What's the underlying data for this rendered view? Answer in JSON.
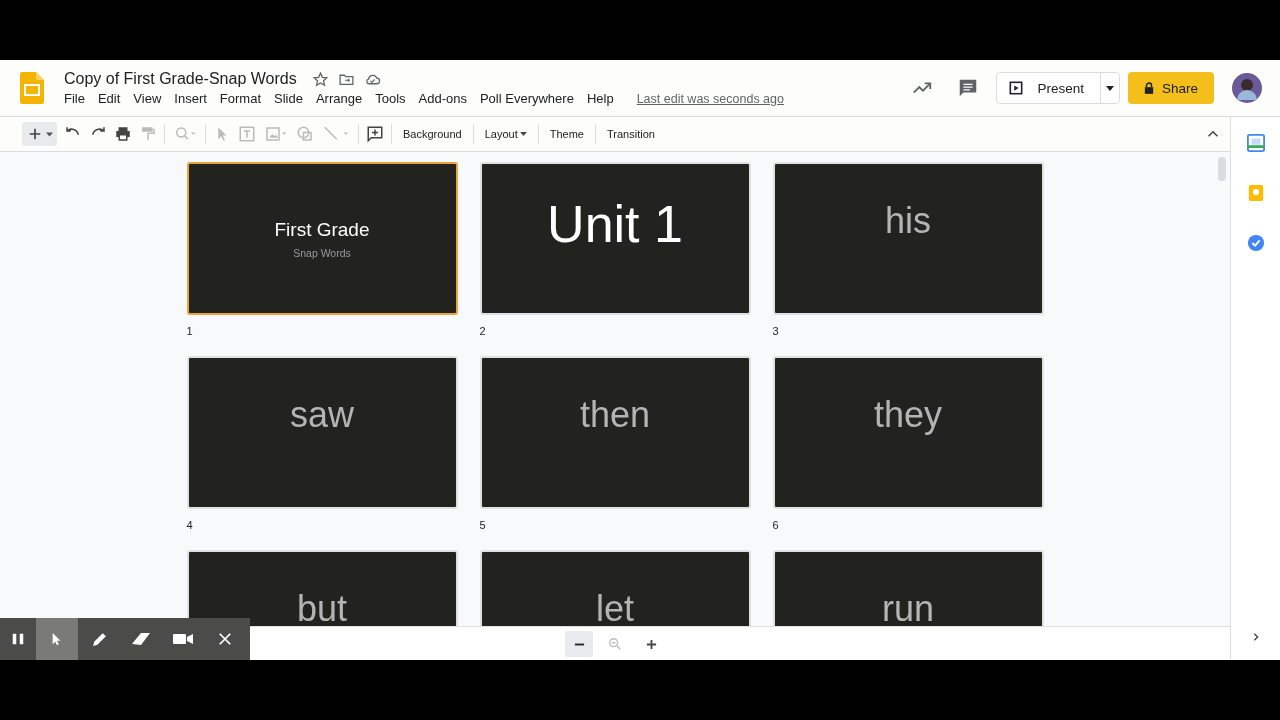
{
  "document": {
    "title": "Copy of First Grade-Snap Words",
    "last_edit": "Last edit was seconds ago"
  },
  "menu": [
    "File",
    "Edit",
    "View",
    "Insert",
    "Format",
    "Slide",
    "Arrange",
    "Tools",
    "Add-ons",
    "Poll Everywhere",
    "Help"
  ],
  "header_buttons": {
    "present": "Present",
    "share": "Share"
  },
  "toolbar": {
    "buttons": [
      "Background",
      "Layout",
      "Theme",
      "Transition"
    ]
  },
  "slides": [
    {
      "kind": "title",
      "number": "1",
      "title": "First Grade",
      "subtitle": "Snap Words",
      "selected": true
    },
    {
      "kind": "heading",
      "number": "2",
      "title": "Unit 1",
      "selected": false
    },
    {
      "kind": "word",
      "number": "3",
      "title": "his",
      "selected": false
    },
    {
      "kind": "word",
      "number": "4",
      "title": "saw",
      "selected": false
    },
    {
      "kind": "word",
      "number": "5",
      "title": "then",
      "selected": false
    },
    {
      "kind": "word",
      "number": "6",
      "title": "they",
      "selected": false
    },
    {
      "kind": "word",
      "title": "but",
      "selected": false
    },
    {
      "kind": "word",
      "title": "let",
      "selected": false
    },
    {
      "kind": "word",
      "title": "run",
      "selected": false
    }
  ]
}
